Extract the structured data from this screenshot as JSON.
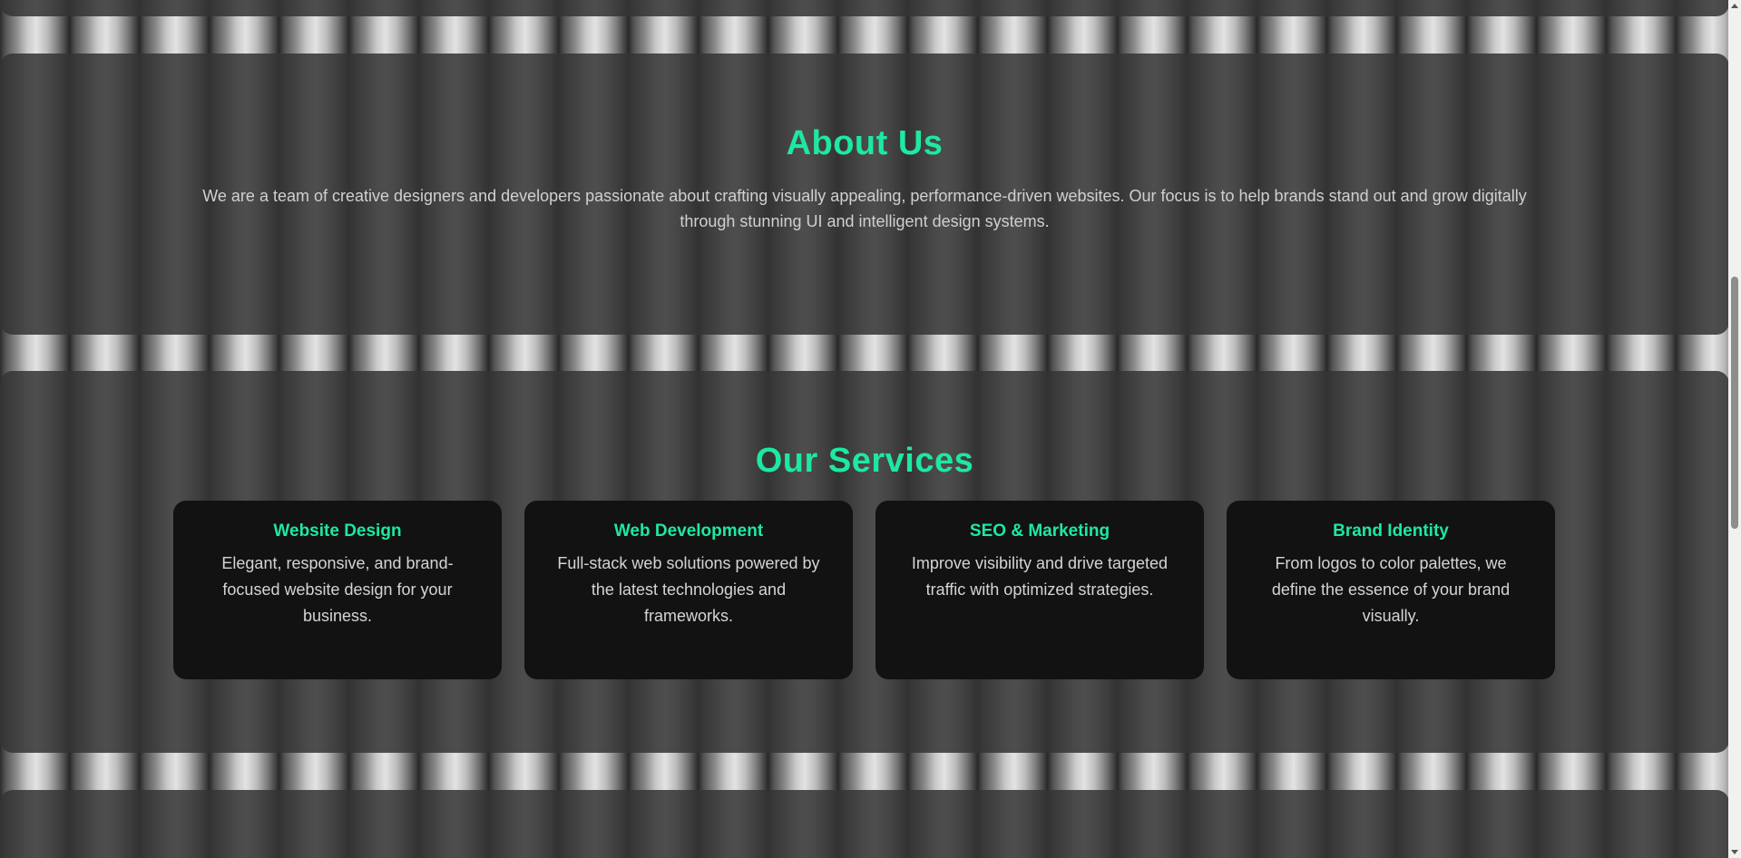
{
  "about": {
    "title": "About Us",
    "text": "We are a team of creative designers and developers passionate about crafting visually appealing, performance-driven websites. Our focus is to help brands stand out and grow digitally through stunning UI and intelligent design systems."
  },
  "services": {
    "title": "Our Services",
    "cards": [
      {
        "title": "Website Design",
        "text": "Elegant, responsive, and brand-focused website design for your business."
      },
      {
        "title": "Web Development",
        "text": "Full-stack web solutions powered by the latest technologies and frameworks."
      },
      {
        "title": "SEO & Marketing",
        "text": "Improve visibility and drive targeted traffic with optimized strategies."
      },
      {
        "title": "Brand Identity",
        "text": "From logos to color palettes, we define the essence of your brand visually."
      }
    ]
  },
  "theme": {
    "accent": "#1de9a0",
    "section_bg": "#343434",
    "card_bg": "#121212"
  }
}
